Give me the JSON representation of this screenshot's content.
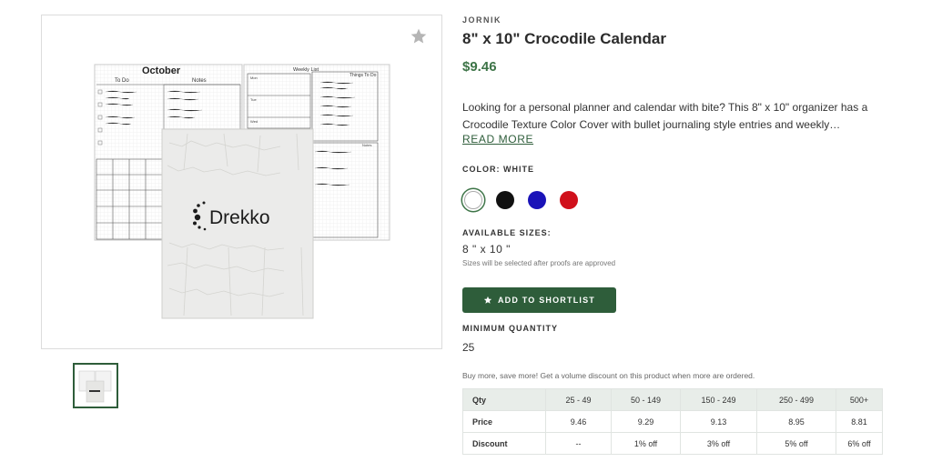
{
  "product": {
    "brand": "JORNIK",
    "title": "8\" x 10\" Crocodile Calendar",
    "price": "$9.46",
    "description": "Looking for a personal planner and calendar with bite? This 8\" x 10\" organizer has a Crocodile Texture Color Cover with bullet journaling style entries and weekly…",
    "read_more": "READ MORE"
  },
  "image": {
    "cover_brand": "Drekko",
    "month": "October",
    "todo": "To Do",
    "notes": "Notes",
    "weekly_list": "Weekly List",
    "things_to_do": "Things To Do",
    "notes2": "Notes",
    "mon": "Mon",
    "tue": "Tue",
    "wed": "Wed"
  },
  "color": {
    "label": "COLOR: WHITE",
    "swatches": [
      {
        "name": "White",
        "hex": "#ffffff",
        "selected": true
      },
      {
        "name": "Black",
        "hex": "#111111",
        "selected": false
      },
      {
        "name": "Blue",
        "hex": "#1a13b8",
        "selected": false
      },
      {
        "name": "Red",
        "hex": "#d0101b",
        "selected": false
      }
    ]
  },
  "sizes": {
    "label": "AVAILABLE SIZES:",
    "value": "8 \" x 10 \"",
    "note": "Sizes will be selected after proofs are approved"
  },
  "shortlist": {
    "label": "ADD TO SHORTLIST",
    "icon": "star-icon"
  },
  "minimum": {
    "label": "MINIMUM QUANTITY",
    "value": "25"
  },
  "volume_note": "Buy more, save more! Get a volume discount on this product when more are ordered.",
  "pricing_table": {
    "header": [
      "Qty",
      "25 - 49",
      "50 - 149",
      "150 - 249",
      "250 - 499",
      "500+"
    ],
    "rows": [
      [
        "Price",
        "9.46",
        "9.29",
        "9.13",
        "8.95",
        "8.81"
      ],
      [
        "Discount",
        "--",
        "1% off",
        "3% off",
        "5% off",
        "6% off"
      ]
    ]
  },
  "colors": {
    "accent": "#2e5d3a",
    "price": "#3d7447",
    "table_header": "#e8ede9"
  }
}
